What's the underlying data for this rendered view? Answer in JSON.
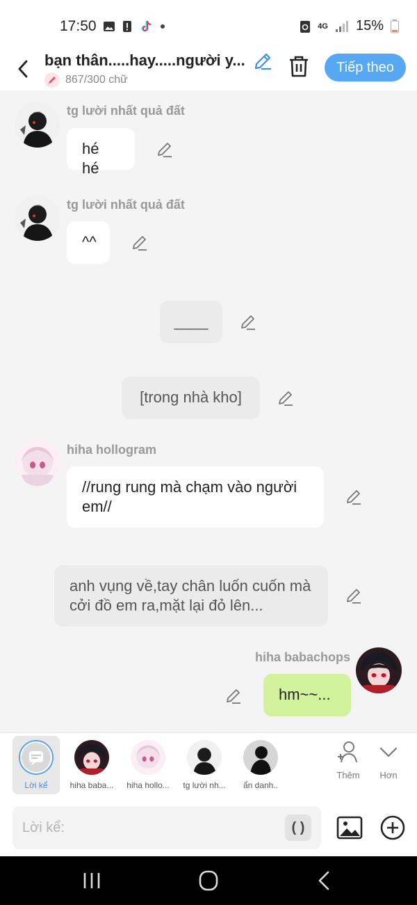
{
  "status_bar": {
    "time": "17:50",
    "network": "4G",
    "battery": "15%"
  },
  "header": {
    "title": "bạn thân.....hay.....người y...",
    "word_count": "867/300 chữ",
    "next_label": "Tiếp theo"
  },
  "messages": [
    {
      "sender": "tg lười nhất quả đất",
      "text": "hé hé"
    },
    {
      "sender": "tg lười nhất quả đất",
      "text": "^^"
    },
    {
      "text": "____"
    },
    {
      "text": "[trong nhà kho]"
    },
    {
      "sender": "hiha hollogram",
      "text": "//rung rung mà chạm vào người em//"
    },
    {
      "text": "anh vụng về,tay chân luốn cuốn mà cởi đồ em ra,mặt lại đỏ lên..."
    },
    {
      "sender": "hiha babachops",
      "text": "hm~~..."
    }
  ],
  "characters": [
    {
      "name": "Lời kể"
    },
    {
      "name": "hiha baba..."
    },
    {
      "name": "hiha hollo..."
    },
    {
      "name": "tg lười nh..."
    },
    {
      "name": "ẩn danh.."
    }
  ],
  "side_actions": {
    "add_label": "Thêm",
    "more_label": "Hơn"
  },
  "composer": {
    "placeholder": "Lời kể:",
    "paren_label": "( )"
  },
  "colors": {
    "accent": "#57a8f2",
    "my_bubble": "#d2f19b",
    "narration_bubble": "#ebebeb"
  }
}
